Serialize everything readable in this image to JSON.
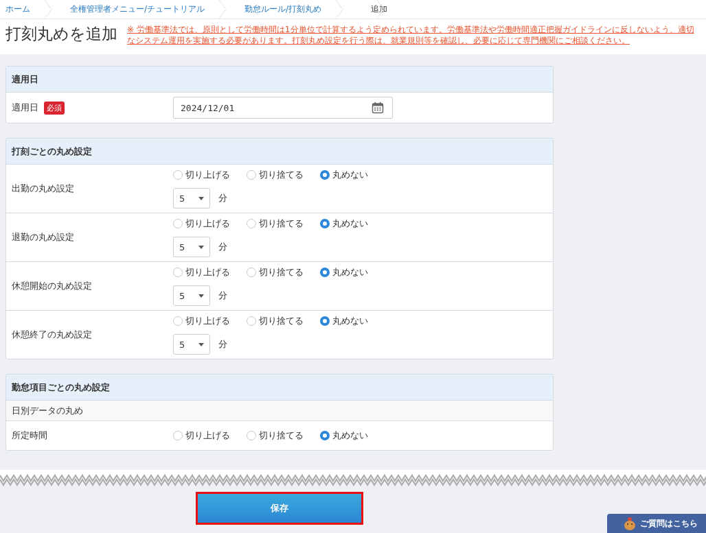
{
  "breadcrumbs": [
    {
      "label": "ホーム",
      "current": false
    },
    {
      "label": "全権管理者メニュー/チュートリアル",
      "current": false
    },
    {
      "label": "勤怠ルール/打刻丸め",
      "current": false
    },
    {
      "label": "追加",
      "current": true
    }
  ],
  "title": "打刻丸めを追加",
  "notice": "※ 労働基準法では、原則として労働時間は1分単位で計算するよう定められています。労働基準法や労働時間適正把握ガイドラインに反しないよう、適切なシステム運用を実施する必要があります。打刻丸め設定を行う際は、就業規則等を確認し、必要に応じて専門機関にご相談ください。",
  "sections": [
    {
      "title": "適用日",
      "rows": [
        {
          "kind": "date",
          "label": "適用日",
          "badge": "必須",
          "value": "2024/12/01"
        }
      ]
    },
    {
      "title": "打刻ごとの丸め設定",
      "rows": [
        {
          "kind": "rounding",
          "label": "出勤の丸め設定",
          "options": [
            {
              "label": "切り上げる",
              "selected": false
            },
            {
              "label": "切り捨てる",
              "selected": false
            },
            {
              "label": "丸めない",
              "selected": true
            }
          ],
          "select": "5",
          "unit": "分"
        },
        {
          "kind": "rounding",
          "label": "退勤の丸め設定",
          "options": [
            {
              "label": "切り上げる",
              "selected": false
            },
            {
              "label": "切り捨てる",
              "selected": false
            },
            {
              "label": "丸めない",
              "selected": true
            }
          ],
          "select": "5",
          "unit": "分"
        },
        {
          "kind": "rounding",
          "label": "休憩開始の丸め設定",
          "options": [
            {
              "label": "切り上げる",
              "selected": false
            },
            {
              "label": "切り捨てる",
              "selected": false
            },
            {
              "label": "丸めない",
              "selected": true
            }
          ],
          "select": "5",
          "unit": "分"
        },
        {
          "kind": "rounding",
          "label": "休憩終了の丸め設定",
          "options": [
            {
              "label": "切り上げる",
              "selected": false
            },
            {
              "label": "切り捨てる",
              "selected": false
            },
            {
              "label": "丸めない",
              "selected": true
            }
          ],
          "select": "5",
          "unit": "分"
        }
      ]
    },
    {
      "title": "勤怠項目ごとの丸め設定",
      "subheading": "日別データの丸め",
      "rows": [
        {
          "kind": "rounding",
          "label": "所定時間",
          "options": [
            {
              "label": "切り上げる",
              "selected": false
            },
            {
              "label": "切り捨てる",
              "selected": false
            },
            {
              "label": "丸めない",
              "selected": true
            }
          ]
        }
      ]
    }
  ],
  "save_button": "保存",
  "help_button": "ご質問はこちら"
}
